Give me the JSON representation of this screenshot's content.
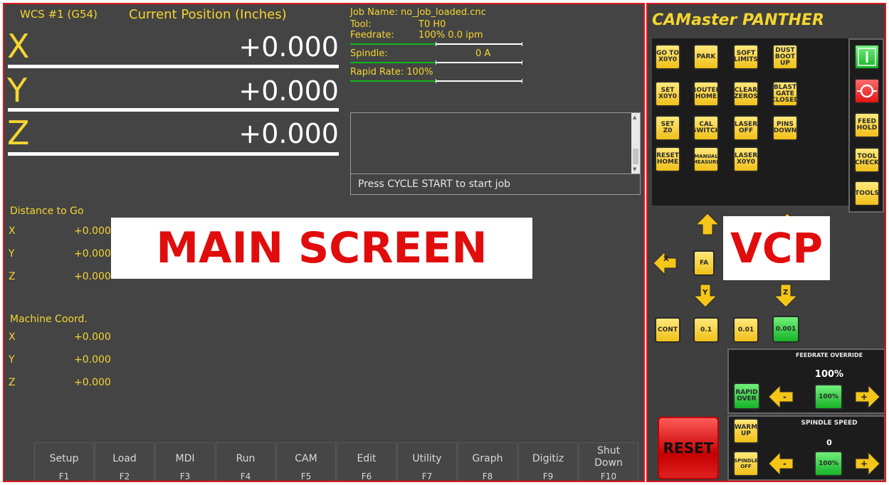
{
  "main": {
    "wcs_label": "WCS #1 (G54)",
    "position_title": "Current Position (Inches)",
    "axes": [
      {
        "axis": "X",
        "value": "+0.000"
      },
      {
        "axis": "Y",
        "value": "+0.000"
      },
      {
        "axis": "Z",
        "value": "+0.000"
      }
    ],
    "job": {
      "name": "Job Name: no_job_loaded.cnc",
      "tool_label": "Tool:",
      "tool_value": "T0  H0",
      "feedrate_label": "Feedrate:",
      "feedrate_value": "100%  0.0 ipm",
      "feedrate_fraction": 0.5,
      "spindle_label": "Spindle:",
      "spindle_value": "0  A",
      "spindle_fraction": 0.5,
      "rapid_label": "Rapid Rate: 100%",
      "rapid_fraction": 0.5
    },
    "message_text": "Press CYCLE START to start job",
    "distance_to_go": {
      "title": "Distance to Go",
      "rows": [
        {
          "axis": "X",
          "value": "+0.000"
        },
        {
          "axis": "Y",
          "value": "+0.000"
        },
        {
          "axis": "Z",
          "value": "+0.000"
        }
      ]
    },
    "machine_coord": {
      "title": "Machine Coord.",
      "rows": [
        {
          "axis": "X",
          "value": "+0.000"
        },
        {
          "axis": "Y",
          "value": "+0.000"
        },
        {
          "axis": "Z",
          "value": "+0.000"
        }
      ]
    },
    "function_keys": [
      {
        "label": "Setup",
        "key": "F1"
      },
      {
        "label": "Load",
        "key": "F2"
      },
      {
        "label": "MDI",
        "key": "F3"
      },
      {
        "label": "Run",
        "key": "F4"
      },
      {
        "label": "CAM",
        "key": "F5"
      },
      {
        "label": "Edit",
        "key": "F6"
      },
      {
        "label": "Utility",
        "key": "F7"
      },
      {
        "label": "Graph",
        "key": "F8"
      },
      {
        "label": "Digitiz",
        "key": "F9"
      },
      {
        "label": "Shut\nDown",
        "key": "F10"
      }
    ],
    "overlay_label": "MAIN SCREEN"
  },
  "vcp": {
    "logo": "CAMaster PANTHER",
    "overlay_label": "VCP",
    "buttons": {
      "goto_xy0": "GO TO X0Y0",
      "park": "PARK",
      "soft_limits": "SOFT LIMITS",
      "dust_boot_up": "DUST BOOT UP",
      "set_xy0": "SET X0Y0",
      "router_home": "ROUTER HOME",
      "clear_zeros": "CLEAR ZEROS",
      "blast_gate_closed": "BLAST GATE CLOSED",
      "set_z0": "SET Z0",
      "cal_switch": "CAL SWITCH",
      "laser_off": "LASER OFF",
      "pins_down": "PINS DOWN",
      "reset_home": "RESET HOME",
      "manual_measure": "MANUAL MEASURE",
      "laser_xy0": "LASER X0Y0",
      "feed_hold": "FEED HOLD",
      "tool_check": "TOOL CHECK",
      "tools": "TOOLS",
      "jog_x": "X",
      "jog_y": "Y",
      "jog_z": "Z",
      "fast": "FA",
      "cont": "CONT",
      "step_01": "0.1",
      "step_001": "0.01",
      "step_0001": "0.001",
      "rapid_over": "RAPID OVER",
      "warm_up": "WARM UP",
      "spindle_off": "SPINDLE OFF",
      "reset": "RESET"
    },
    "feedrate_override": {
      "title": "FEEDRATE OVERRIDE",
      "value": "100%",
      "button": "100%"
    },
    "spindle_speed": {
      "title": "SPINDLE SPEED",
      "value": "0",
      "button": "100%"
    }
  }
}
